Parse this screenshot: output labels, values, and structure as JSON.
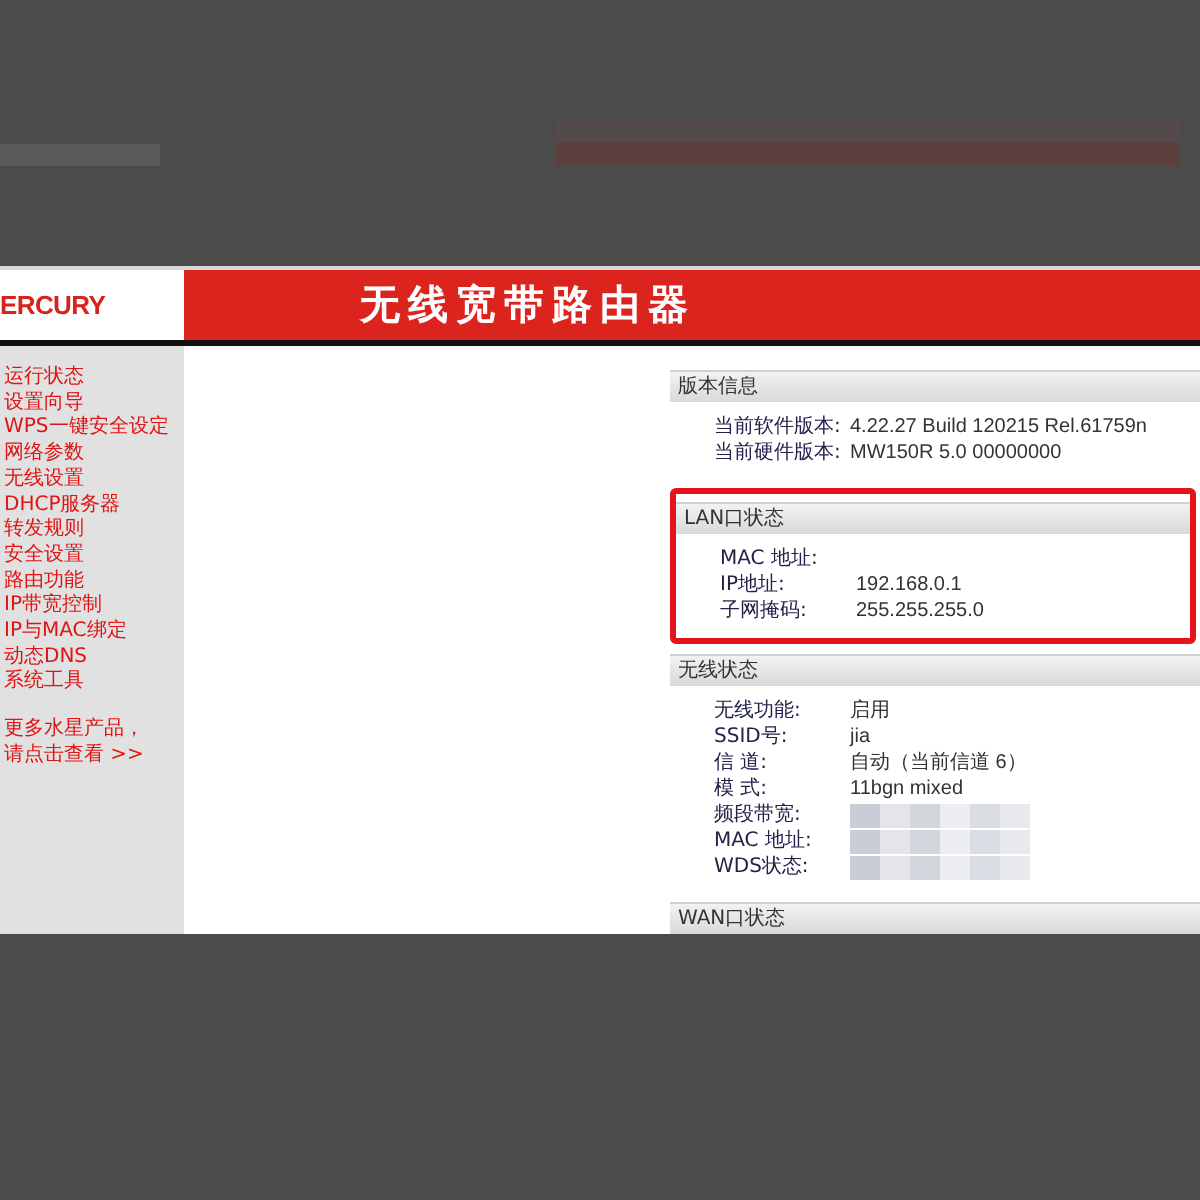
{
  "window": {
    "logo": "ERCURY",
    "title": "无线宽带路由器"
  },
  "sidebar": {
    "items": [
      "运行状态",
      "设置向导",
      "WPS一键安全设定",
      "网络参数",
      "无线设置",
      "DHCP服务器",
      "转发规则",
      "安全设置",
      "路由功能",
      "IP带宽控制",
      "IP与MAC绑定",
      "动态DNS",
      "系统工具"
    ],
    "promo_text": "更多水星产品，",
    "promo_link": "请点击查看 >>"
  },
  "panel": {
    "sections": [
      {
        "title": "版本信息",
        "highlighted": false,
        "rows": [
          {
            "label": "当前软件版本:",
            "value": "4.22.27 Build 120215 Rel.61759n",
            "blurred": false
          },
          {
            "label": "当前硬件版本:",
            "value": "MW150R 5.0 00000000",
            "blurred": false
          }
        ]
      },
      {
        "title": "LAN口状态",
        "highlighted": true,
        "rows": [
          {
            "label": "MAC 地址:",
            "blurred": false
          },
          {
            "label": "IP地址:",
            "value": "192.168.0.1",
            "blurred": false
          },
          {
            "label": "子网掩码:",
            "value": "255.255.255.0",
            "blurred": false
          }
        ]
      },
      {
        "title": "无线状态",
        "highlighted": false,
        "rows": [
          {
            "label": "无线功能:",
            "value": "启用",
            "blurred": false
          },
          {
            "label": "SSID号:",
            "value": "jia",
            "blurred": false
          },
          {
            "label": "信 道:",
            "value": "自动（当前信道 6）",
            "blurred": false
          },
          {
            "label": "模 式:",
            "value": "11bgn mixed",
            "blurred": false
          },
          {
            "label": "频段带宽:",
            "blurred": true
          },
          {
            "label": "MAC 地址:",
            "blurred": true
          },
          {
            "label": "WDS状态:",
            "blurred": true
          }
        ]
      },
      {
        "title": "WAN口状态",
        "highlighted": false
      }
    ]
  }
}
